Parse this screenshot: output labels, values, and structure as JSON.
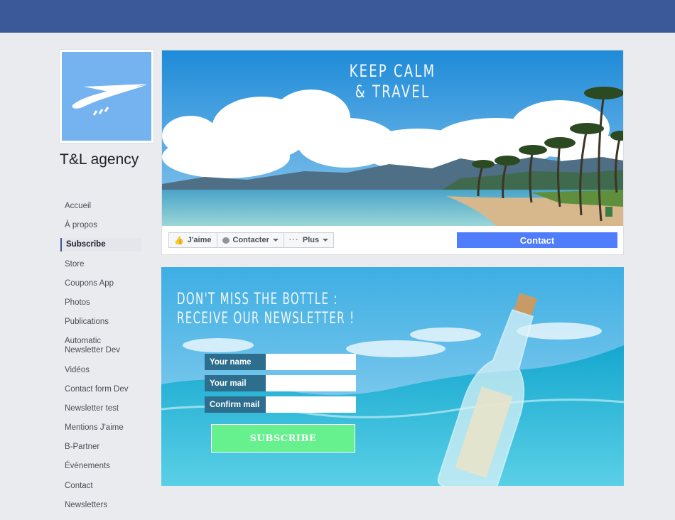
{
  "page": {
    "name": "T&L agency"
  },
  "sidebar": {
    "items": [
      {
        "label": "Accueil"
      },
      {
        "label": "À propos"
      },
      {
        "label": "Subscribe"
      },
      {
        "label": "Store"
      },
      {
        "label": "Coupons App"
      },
      {
        "label": "Photos"
      },
      {
        "label": "Publications"
      },
      {
        "label": "Automatic Newsletter Dev"
      },
      {
        "label": "Vidéos"
      },
      {
        "label": "Contact form Dev"
      },
      {
        "label": "Newsletter test"
      },
      {
        "label": "Mentions J'aime"
      },
      {
        "label": "B-Partner"
      },
      {
        "label": "Évènements"
      },
      {
        "label": "Contact"
      },
      {
        "label": "Newsletters"
      }
    ],
    "active_index": 2
  },
  "cover": {
    "line1": "KEEP CALM",
    "line2": "& TRAVEL"
  },
  "actions": {
    "like": "J'aime",
    "contact_dropdown": "Contacter",
    "more": "Plus",
    "contact_button": "Contact"
  },
  "newsletter": {
    "title_line1": "DON'T MISS THE BOTTLE :",
    "title_line2": "RECEIVE OUR NEWSLETTER !",
    "fields": [
      {
        "label": "Your name",
        "value": ""
      },
      {
        "label": "Your mail",
        "value": ""
      },
      {
        "label": "Confirm mail",
        "value": ""
      }
    ],
    "subscribe": "SUBSCRIBE"
  },
  "colors": {
    "topbar": "#3b5998",
    "contact_button": "#4f7dfb",
    "subscribe_button": "#66f08e",
    "field_label": "#2d6e8e",
    "profile_bg": "#74b3f0"
  }
}
